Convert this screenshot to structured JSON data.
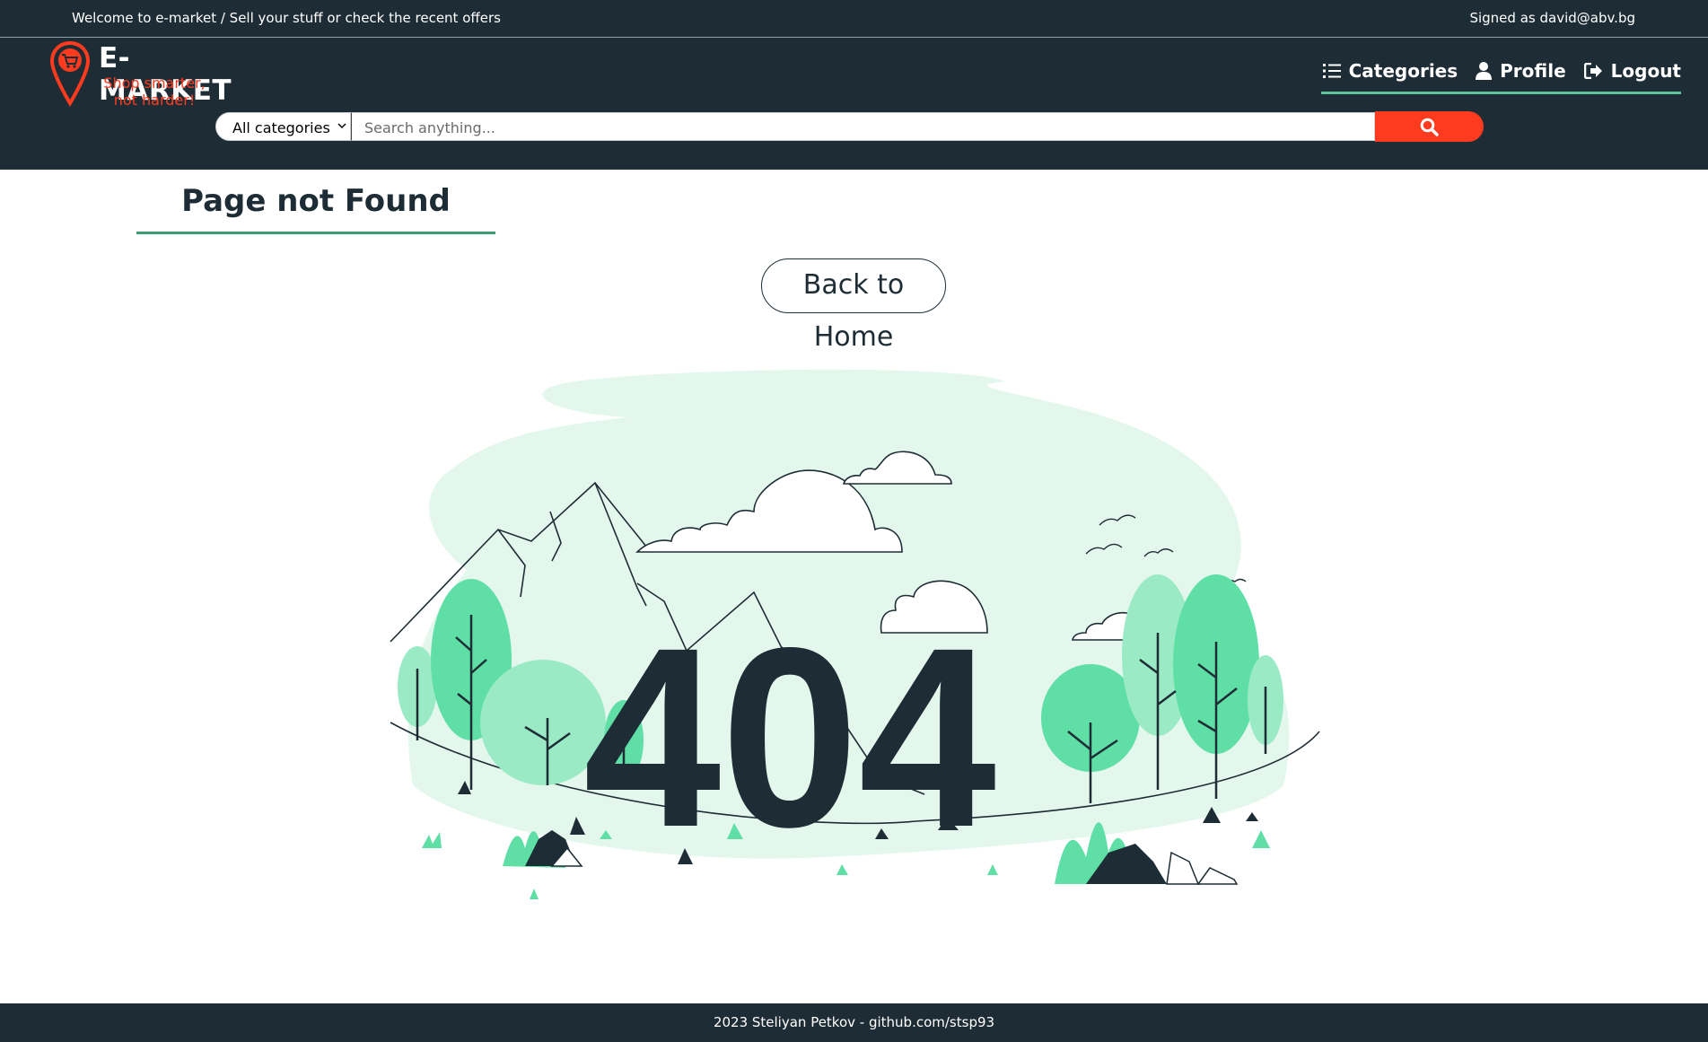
{
  "topbar": {
    "welcome": "Welcome to e-market / Sell your stuff or check the recent offers",
    "signed_in": "Signed as david@abv.bg"
  },
  "brand": {
    "name": "E-MARKET",
    "tagline": "Shop smarter, not harder!",
    "accent_color": "#ff3b1f",
    "dark_color": "#1e2d35",
    "highlight_color": "#5fc19a"
  },
  "nav": {
    "items": [
      {
        "label": "Categories",
        "icon": "list-icon"
      },
      {
        "label": "Profile",
        "icon": "user-icon"
      },
      {
        "label": "Logout",
        "icon": "logout-icon"
      }
    ]
  },
  "search": {
    "category_selected": "All categories",
    "placeholder": "Search anything...",
    "button_icon": "search-icon"
  },
  "main": {
    "title": "Page not Found",
    "home_button": "Back to Home",
    "error_code": "404"
  },
  "footer": {
    "text": "2023 Steliyan Petkov - github.com/stsp93"
  }
}
